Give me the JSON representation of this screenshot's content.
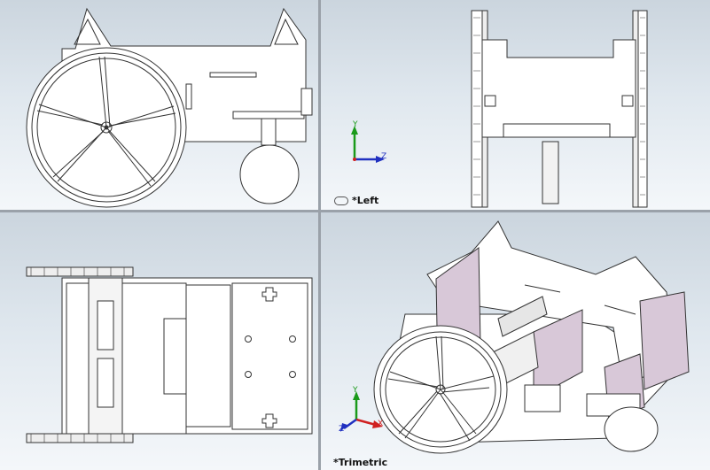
{
  "viewports": {
    "top_left": {
      "label": ""
    },
    "top_right": {
      "label": "*Left"
    },
    "bottom_left": {
      "label": ""
    },
    "bottom_right": {
      "label": "*Trimetric"
    }
  },
  "triad": {
    "x": "X",
    "y": "Y",
    "z": "Z"
  },
  "colors": {
    "axis_x": "#d02020",
    "axis_y": "#1a9a1a",
    "axis_z": "#2030c0",
    "panel_fill": "#d8c8d8"
  },
  "icons": {
    "view_link": "link-icon"
  }
}
